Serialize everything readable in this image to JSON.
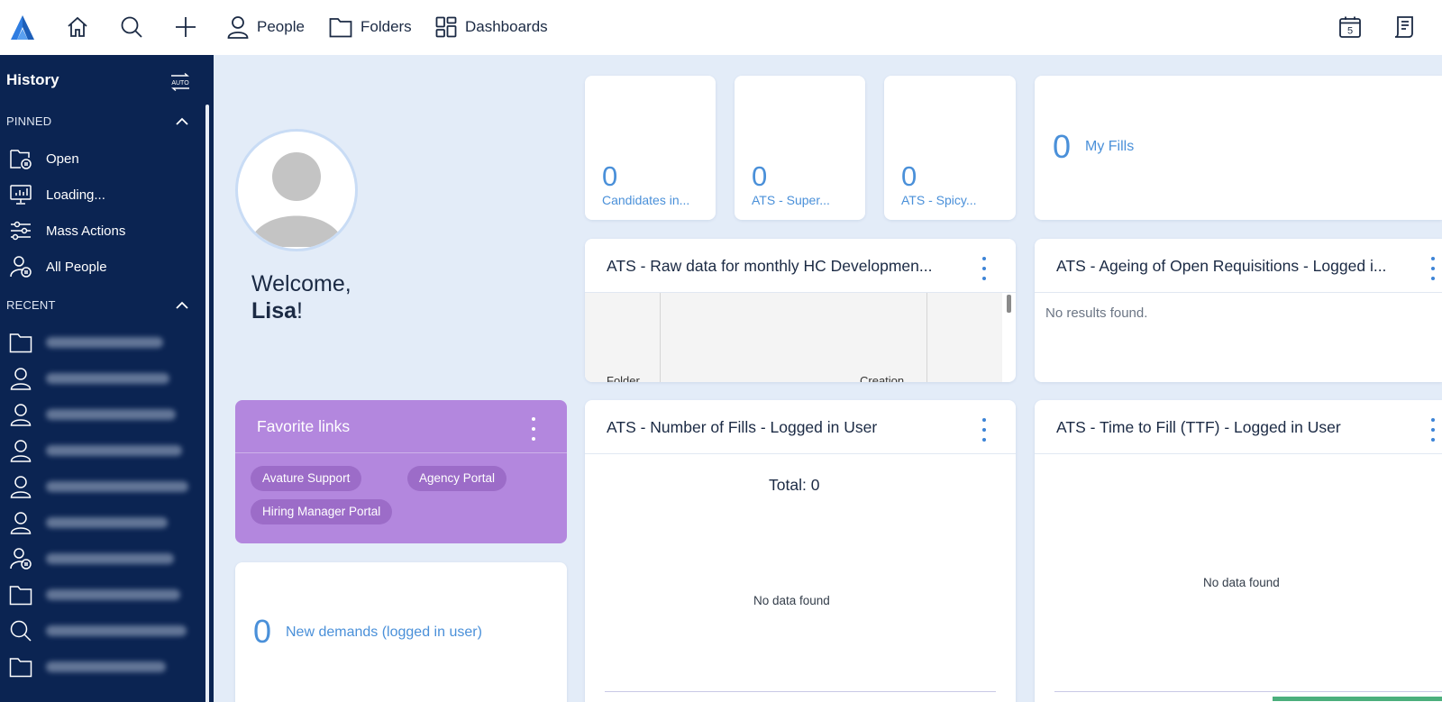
{
  "topbar": {
    "nav": [
      {
        "label": "People",
        "icon": "person-icon"
      },
      {
        "label": "Folders",
        "icon": "folder-icon"
      },
      {
        "label": "Dashboards",
        "icon": "dashboard-grid-icon"
      }
    ],
    "calendar_day": "5"
  },
  "sidebar": {
    "title": "History",
    "auto_label": "AUTO",
    "pinned_label": "PINNED",
    "recent_label": "RECENT",
    "pinned": [
      {
        "label": "Open",
        "icon": "folder-list-icon"
      },
      {
        "label": "Loading...",
        "icon": "chart-board-icon"
      },
      {
        "label": "Mass Actions",
        "icon": "sliders-icon"
      },
      {
        "label": "All People",
        "icon": "people-list-icon"
      }
    ],
    "recent_icons": [
      "folder-icon",
      "person-icon",
      "person-icon",
      "person-icon",
      "person-icon",
      "person-icon",
      "person-list-icon",
      "folder-icon",
      "search-icon",
      "folder-icon"
    ]
  },
  "welcome": {
    "greeting": "Welcome,",
    "name": "Lisa",
    "suffix": "!"
  },
  "stats": [
    {
      "value": "0",
      "label": "Candidates in..."
    },
    {
      "value": "0",
      "label": "ATS - Super..."
    },
    {
      "value": "0",
      "label": "ATS - Spicy..."
    }
  ],
  "my_fills": {
    "value": "0",
    "label": "My Fills"
  },
  "widgets": {
    "raw_data": {
      "title": "ATS - Raw data for monthly HC Developmen...",
      "col1": "Folder",
      "col2": "Creation"
    },
    "ageing": {
      "title": "ATS - Ageing of Open Requisitions - Logged i...",
      "empty": "No results found."
    },
    "fills": {
      "title": "ATS - Number of Fills - Logged in User",
      "total": "Total: 0",
      "empty": "No data found"
    },
    "ttf": {
      "title": "ATS - Time to Fill (TTF) - Logged in User",
      "empty": "No data found"
    }
  },
  "favorites": {
    "title": "Favorite links",
    "links": [
      "Avature Support",
      "Agency Portal",
      "Hiring Manager Portal"
    ]
  },
  "new_demands": {
    "value": "0",
    "label": "New demands (logged in user)"
  },
  "colors": {
    "sidebar": "#0b2452",
    "accent": "#4a90d9",
    "favorites": "#b387de",
    "background": "#e3ecf8"
  }
}
